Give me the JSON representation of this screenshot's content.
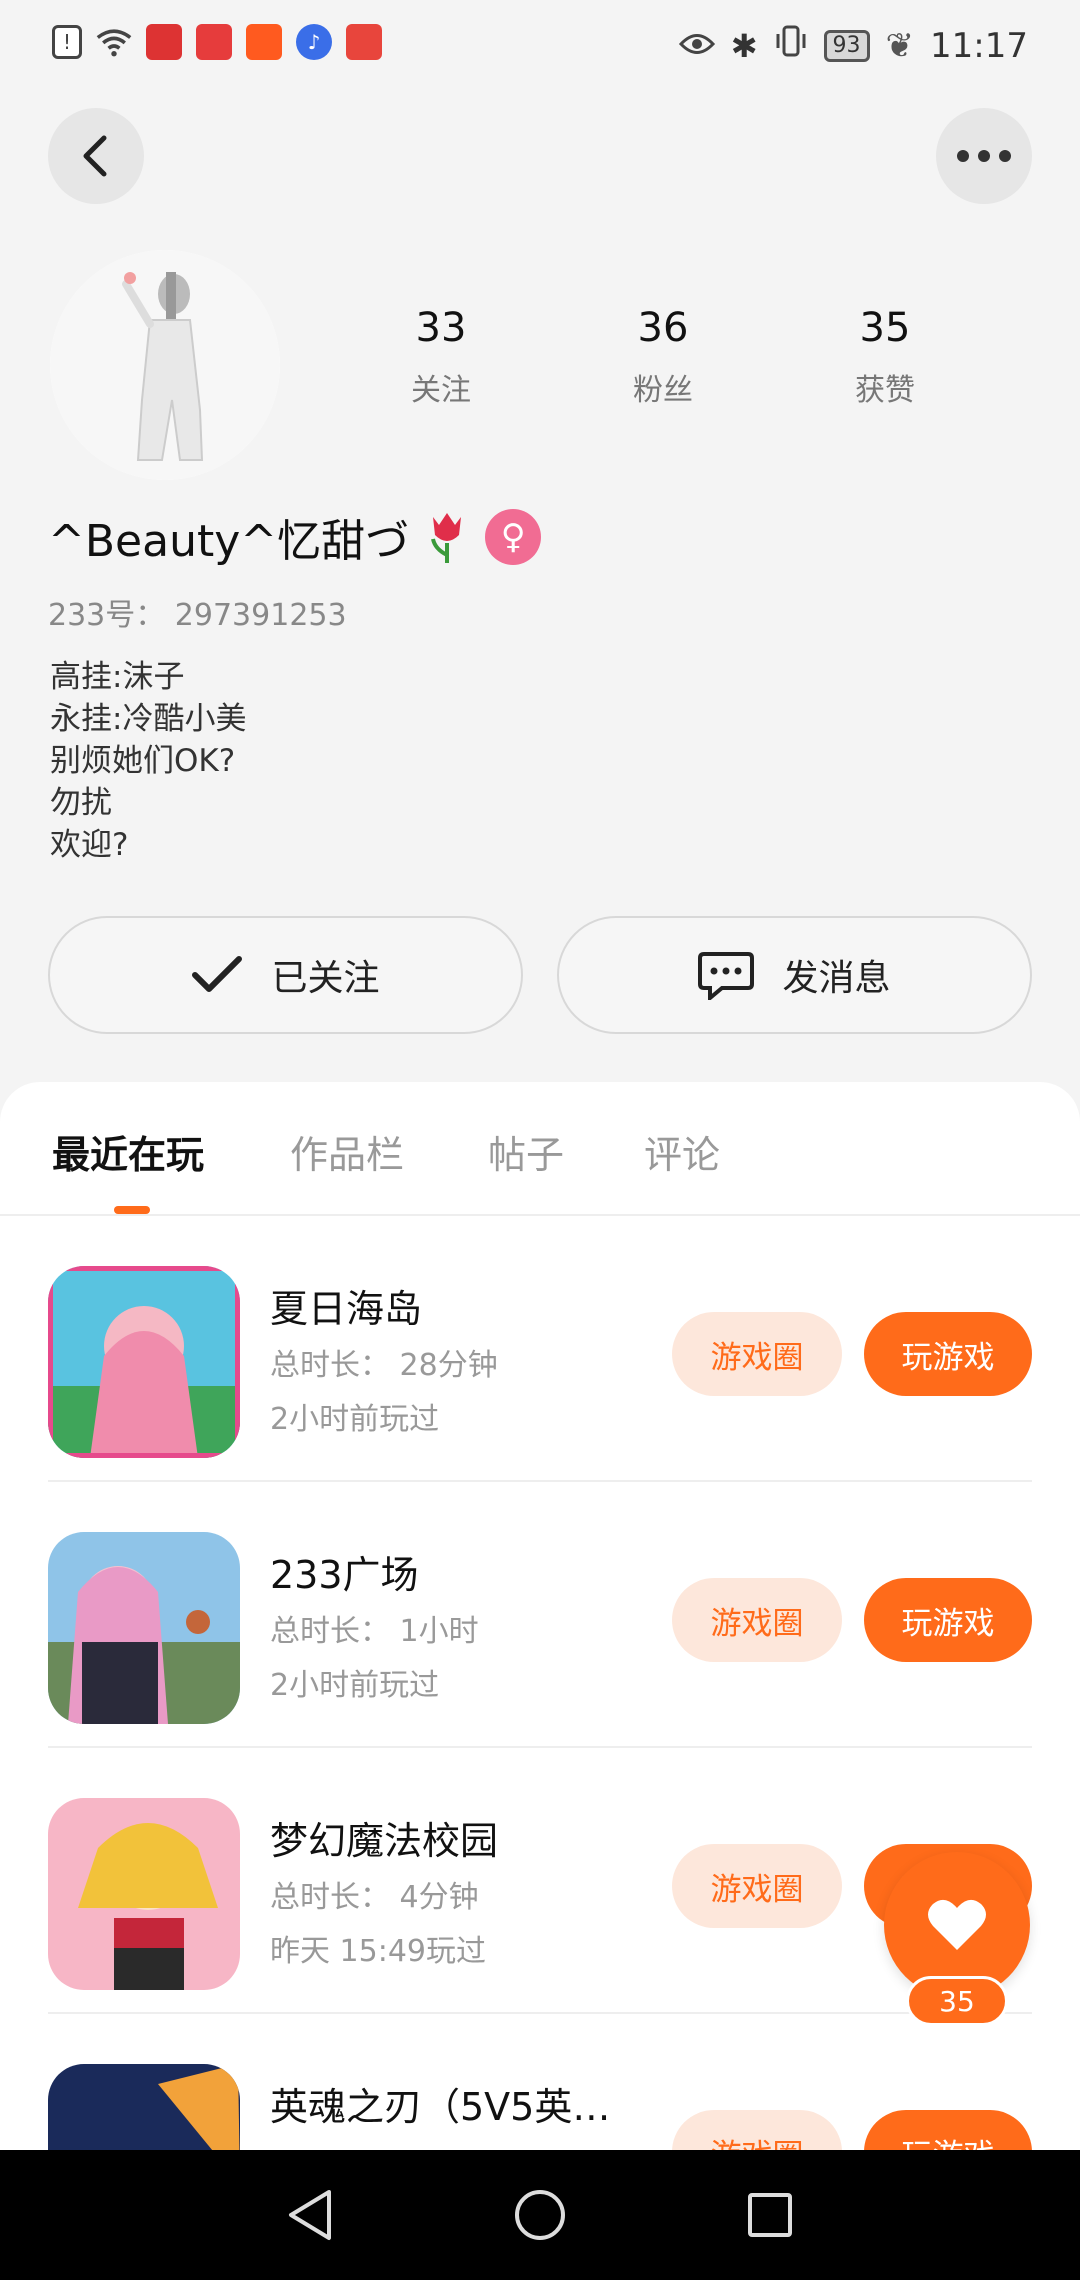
{
  "status_bar": {
    "battery": "93",
    "time": "11:17"
  },
  "profile": {
    "stats": [
      {
        "value": "33",
        "label": "关注"
      },
      {
        "value": "36",
        "label": "粉丝"
      },
      {
        "value": "35",
        "label": "获赞"
      }
    ],
    "username": "^Beauty^忆甜づ",
    "gender_symbol": "♀",
    "uid": "233号： 297391253",
    "bio": [
      "高挂:沫子",
      "永挂:冷酷小美",
      "别烦她们OK?",
      "勿扰",
      "欢迎?"
    ],
    "follow_label": "已关注",
    "message_label": "发消息"
  },
  "tabs": [
    {
      "label": "最近在玩",
      "active": true
    },
    {
      "label": "作品栏",
      "active": false
    },
    {
      "label": "帖子",
      "active": false
    },
    {
      "label": "评论",
      "active": false
    }
  ],
  "games": [
    {
      "title": "夏日海岛",
      "duration": "总时长： 28分钟",
      "last_played": "2小时前玩过",
      "circle_label": "游戏圈",
      "play_label": "玩游戏"
    },
    {
      "title": "233广场",
      "duration": "总时长： 1小时",
      "last_played": "2小时前玩过",
      "circle_label": "游戏圈",
      "play_label": "玩游戏"
    },
    {
      "title": "梦幻魔法校园",
      "duration": "总时长： 4分钟",
      "last_played": "昨天 15:49玩过",
      "circle_label": "游戏圈",
      "play_label": "玩游戏"
    },
    {
      "title": "英魂之刃（5V5英…",
      "duration": "",
      "last_played": "",
      "circle_label": "游戏圈",
      "play_label": "玩游戏"
    }
  ],
  "like_fab": {
    "count": "35"
  },
  "colors": {
    "accent": "#ff6b1a",
    "accent_light": "#fde7db",
    "gender": "#f16c93"
  }
}
